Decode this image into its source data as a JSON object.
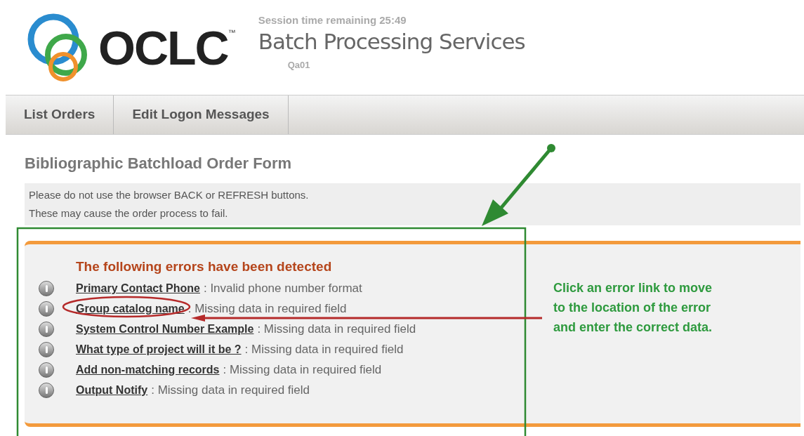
{
  "header": {
    "logo_text": "OCLC",
    "trademark": "™",
    "session": "Session time remaining  25:49",
    "app_title": "Batch Processing Services",
    "instance": "Qa01"
  },
  "tabs": [
    {
      "label": "List Orders"
    },
    {
      "label": "Edit Logon Messages"
    }
  ],
  "page_title": "Bibliographic Batchload Order Form",
  "notice": [
    "Please do not use the browser BACK or REFRESH buttons.",
    "These may cause the order process to fail."
  ],
  "errors": {
    "heading": "The following errors have been detected",
    "items": [
      {
        "field": "Primary Contact Phone",
        "message": ": Invalid phone number format"
      },
      {
        "field": "Group catalog name",
        "message": ": Missing data in required field"
      },
      {
        "field": "System Control Number Example",
        "message": ": Missing data in required field"
      },
      {
        "field": "What type of project will it be ?",
        "message": ": Missing data in required field"
      },
      {
        "field": "Add non-matching records",
        "message": ": Missing data in required field"
      },
      {
        "field": "Output Notify",
        "message": ": Missing data in required field"
      }
    ]
  },
  "hint": "Click an error link to move to the location of the error and enter the correct data."
}
